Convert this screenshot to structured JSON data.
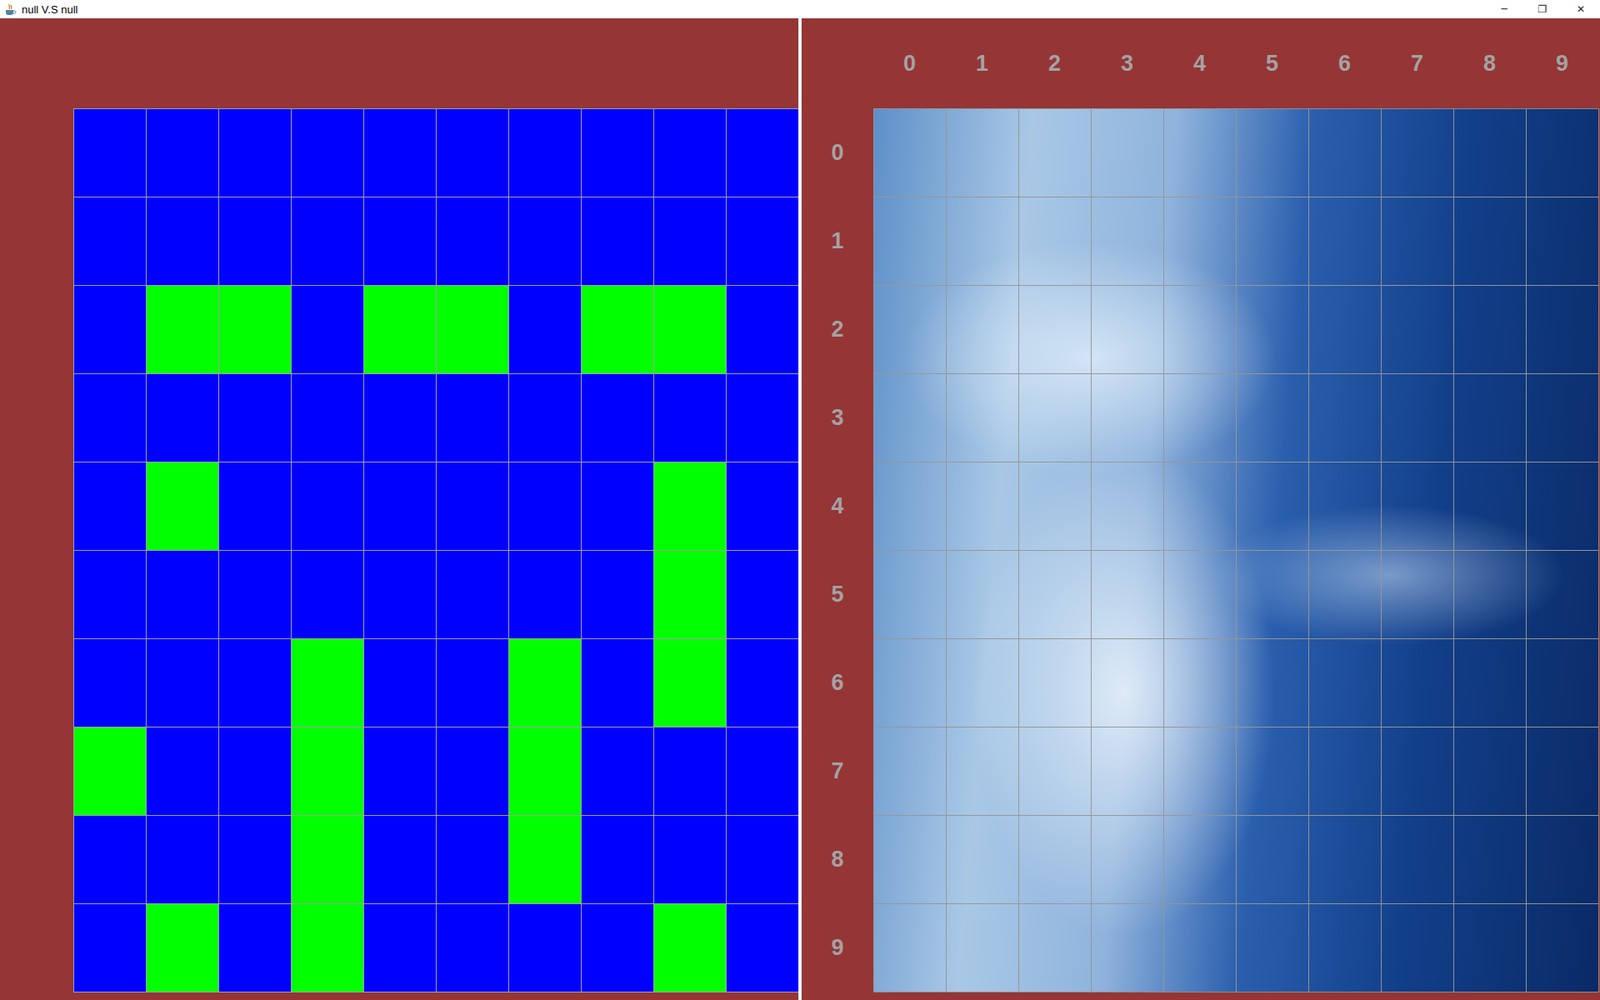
{
  "window": {
    "title": "null V.S null",
    "controls": [
      "─",
      "❐",
      "✕"
    ]
  },
  "own_board": {
    "rows": [
      [
        {
          "ship": false
        },
        {
          "ship": false
        },
        {
          "ship": false
        },
        {
          "ship": false
        },
        {
          "ship": false
        },
        {
          "ship": false
        },
        {
          "ship": false
        },
        {
          "ship": false
        },
        {
          "ship": false
        },
        {
          "ship": false
        }
      ],
      [
        {
          "ship": false
        },
        {
          "ship": false
        },
        {
          "ship": false
        },
        {
          "ship": false
        },
        {
          "ship": false
        },
        {
          "ship": false
        },
        {
          "ship": false
        },
        {
          "ship": false
        },
        {
          "ship": false
        },
        {
          "ship": false
        }
      ],
      [
        {
          "ship": false
        },
        {
          "ship": true
        },
        {
          "ship": true
        },
        {
          "ship": false
        },
        {
          "ship": true
        },
        {
          "ship": true
        },
        {
          "ship": false
        },
        {
          "ship": true
        },
        {
          "ship": true
        },
        {
          "ship": false
        }
      ],
      [
        {
          "ship": false
        },
        {
          "ship": false
        },
        {
          "ship": false
        },
        {
          "ship": false
        },
        {
          "ship": false
        },
        {
          "ship": false
        },
        {
          "ship": false
        },
        {
          "ship": false
        },
        {
          "ship": false
        },
        {
          "ship": false
        }
      ],
      [
        {
          "ship": false
        },
        {
          "ship": true
        },
        {
          "ship": false
        },
        {
          "ship": false
        },
        {
          "ship": false
        },
        {
          "ship": false
        },
        {
          "ship": false
        },
        {
          "ship": false
        },
        {
          "ship": true
        },
        {
          "ship": false
        }
      ],
      [
        {
          "ship": false
        },
        {
          "ship": false
        },
        {
          "ship": false
        },
        {
          "ship": false
        },
        {
          "ship": false
        },
        {
          "ship": false
        },
        {
          "ship": false
        },
        {
          "ship": false
        },
        {
          "ship": true
        },
        {
          "ship": false
        }
      ],
      [
        {
          "ship": false
        },
        {
          "ship": false
        },
        {
          "ship": false
        },
        {
          "ship": true
        },
        {
          "ship": false
        },
        {
          "ship": false
        },
        {
          "ship": true
        },
        {
          "ship": false
        },
        {
          "ship": true
        },
        {
          "ship": false
        }
      ],
      [
        {
          "ship": true
        },
        {
          "ship": false
        },
        {
          "ship": false
        },
        {
          "ship": true
        },
        {
          "ship": false
        },
        {
          "ship": false
        },
        {
          "ship": true
        },
        {
          "ship": false
        },
        {
          "ship": false
        },
        {
          "ship": false
        }
      ],
      [
        {
          "ship": false
        },
        {
          "ship": false
        },
        {
          "ship": false
        },
        {
          "ship": true
        },
        {
          "ship": false
        },
        {
          "ship": false
        },
        {
          "ship": true
        },
        {
          "ship": false
        },
        {
          "ship": false
        },
        {
          "ship": false
        }
      ],
      [
        {
          "ship": false
        },
        {
          "ship": true
        },
        {
          "ship": false
        },
        {
          "ship": true
        },
        {
          "ship": false
        },
        {
          "ship": false
        },
        {
          "ship": false
        },
        {
          "ship": false
        },
        {
          "ship": true
        },
        {
          "ship": false
        }
      ]
    ]
  },
  "target_board": {
    "column_labels": [
      "0",
      "1",
      "2",
      "3",
      "4",
      "5",
      "6",
      "7",
      "8",
      "9"
    ],
    "row_labels": [
      "0",
      "1",
      "2",
      "3",
      "4",
      "5",
      "6",
      "7",
      "8",
      "9"
    ]
  }
}
